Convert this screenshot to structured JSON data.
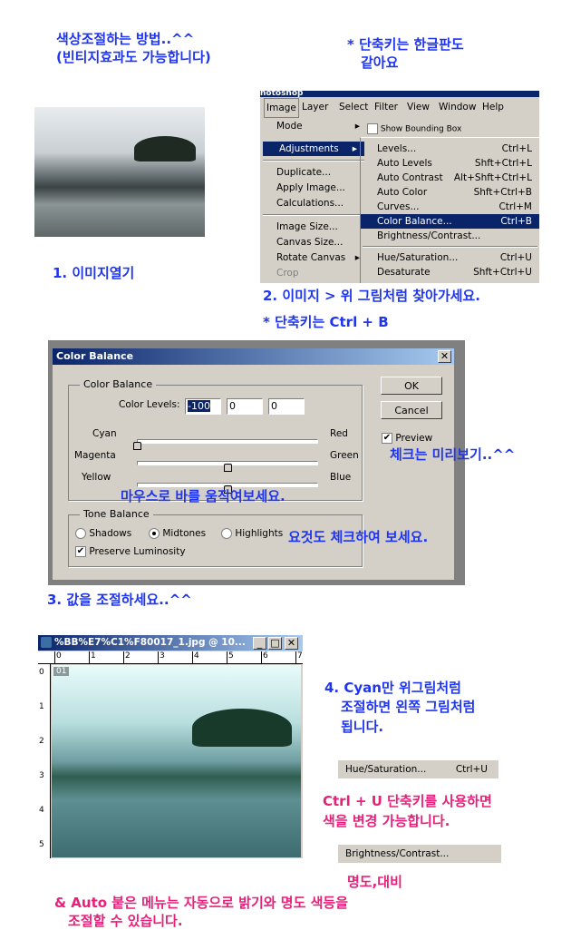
{
  "notes": {
    "title1": "색상조절하는 방법..^^",
    "title2": "(빈티지효과도 가능합니다)",
    "shortcut_note1": "* 단축키는 한글판도",
    "shortcut_note2": "같아요",
    "step1": "1. 이미지열기",
    "step2": "2. 이미지 > 위 그림처럼 찾아가세요.",
    "step2_shortcut": "* 단축키는 Ctrl + B",
    "preview_note": "체크는 미리보기..^^",
    "slider_note": "마우스로 바를 움직여보세요.",
    "tone_note": "요것도 체크하여 보세요.",
    "step3": "3. 값을 조절하세요..^^",
    "step4_1": "4. Cyan만 위그림처럼",
    "step4_2": "조절하면 왼쪽 그림처럼",
    "step4_3": "됩니다.",
    "ctrl_u_1": "Ctrl + U 단축키를 사용하면",
    "ctrl_u_2": "색을 변경 가능합니다.",
    "brightness_note": "명도,대비",
    "auto_note1": "& Auto 붙은 메뉴는 자동으로 밝기와 명도 색등을",
    "auto_note2": "조절할 수 있습니다."
  },
  "menu": {
    "app_title": "hotoshop",
    "menubar": [
      "Image",
      "Layer",
      "Select",
      "Filter",
      "View",
      "Window",
      "Help"
    ],
    "options_bar": "Show Bounding Box",
    "image_menu": [
      "Mode",
      "Adjustments",
      "Duplicate...",
      "Apply Image...",
      "Calculations...",
      "Image Size...",
      "Canvas Size...",
      "Rotate Canvas",
      "Crop"
    ],
    "adjustments": [
      {
        "label": "Levels...",
        "shortcut": "Ctrl+L"
      },
      {
        "label": "Auto Levels",
        "shortcut": "Shft+Ctrl+L"
      },
      {
        "label": "Auto Contrast",
        "shortcut": "Alt+Shft+Ctrl+L"
      },
      {
        "label": "Auto Color",
        "shortcut": "Shft+Ctrl+B"
      },
      {
        "label": "Curves...",
        "shortcut": "Ctrl+M"
      },
      {
        "label": "Color Balance...",
        "shortcut": "Ctrl+B"
      },
      {
        "label": "Brightness/Contrast...",
        "shortcut": ""
      },
      {
        "label": "Hue/Saturation...",
        "shortcut": "Ctrl+U"
      },
      {
        "label": "Desaturate",
        "shortcut": "Shft+Ctrl+U"
      }
    ]
  },
  "dialog": {
    "title": "Color Balance",
    "group1": "Color Balance",
    "levels_label": "Color Levels:",
    "levels": [
      "-100",
      "0",
      "0"
    ],
    "slider_values": [
      -100,
      0,
      0
    ],
    "left_labels": [
      "Cyan",
      "Magenta",
      "Yellow"
    ],
    "right_labels": [
      "Red",
      "Green",
      "Blue"
    ],
    "ok": "OK",
    "cancel": "Cancel",
    "preview": "Preview",
    "preview_checked": true,
    "group2": "Tone Balance",
    "tones": [
      "Shadows",
      "Midtones",
      "Highlights"
    ],
    "selected_tone": "Midtones",
    "preserve": "Preserve Luminosity",
    "preserve_checked": true
  },
  "image_window": {
    "title": "%BB%E7%C1%F80017_1.jpg @ 10...",
    "ruler_top": [
      "0",
      "1",
      "2",
      "3",
      "4",
      "5",
      "6",
      "7"
    ],
    "ruler_left": [
      "0",
      "1",
      "2",
      "3",
      "4",
      "5"
    ],
    "layer_badge": "01"
  },
  "strips": {
    "hue": {
      "label": "Hue/Saturation...",
      "shortcut": "Ctrl+U"
    },
    "brightness": {
      "label": "Brightness/Contrast..."
    }
  },
  "colors": {
    "note_blue": "#1f35f0",
    "note_magenta": "#e8207a",
    "highlight": "#0a246a"
  }
}
